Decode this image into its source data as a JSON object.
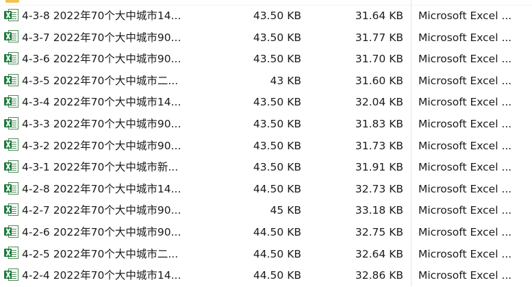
{
  "file_list": {
    "rows": [
      {
        "name": "4-3-8 2022年70个大中城市14...",
        "size": "43.50 KB",
        "packed": "31.64 KB",
        "type": "Microsoft Excel ..."
      },
      {
        "name": "4-3-7 2022年70个大中城市90...",
        "size": "43.50 KB",
        "packed": "31.77 KB",
        "type": "Microsoft Excel ..."
      },
      {
        "name": "4-3-6 2022年70个大中城市90...",
        "size": "43.50 KB",
        "packed": "31.70 KB",
        "type": "Microsoft Excel ..."
      },
      {
        "name": "4-3-5 2022年70个大中城市二...",
        "size": "43 KB",
        "packed": "31.60 KB",
        "type": "Microsoft Excel ..."
      },
      {
        "name": "4-3-4 2022年70个大中城市14...",
        "size": "43.50 KB",
        "packed": "32.04 KB",
        "type": "Microsoft Excel ..."
      },
      {
        "name": "4-3-3 2022年70个大中城市90...",
        "size": "43.50 KB",
        "packed": "31.83 KB",
        "type": "Microsoft Excel ..."
      },
      {
        "name": "4-3-2 2022年70个大中城市90...",
        "size": "43.50 KB",
        "packed": "31.73 KB",
        "type": "Microsoft Excel ..."
      },
      {
        "name": "4-3-1 2022年70个大中城市新...",
        "size": "43.50 KB",
        "packed": "31.91 KB",
        "type": "Microsoft Excel ..."
      },
      {
        "name": "4-2-8 2022年70个大中城市14...",
        "size": "44.50 KB",
        "packed": "32.73 KB",
        "type": "Microsoft Excel ..."
      },
      {
        "name": "4-2-7 2022年70个大中城市90...",
        "size": "45 KB",
        "packed": "33.18 KB",
        "type": "Microsoft Excel ..."
      },
      {
        "name": "4-2-6 2022年70个大中城市90...",
        "size": "44.50 KB",
        "packed": "32.75 KB",
        "type": "Microsoft Excel ..."
      },
      {
        "name": "4-2-5 2022年70个大中城市二...",
        "size": "44.50 KB",
        "packed": "32.64 KB",
        "type": "Microsoft Excel ..."
      },
      {
        "name": "4-2-4 2022年70个大中城市14...",
        "size": "44.50 KB",
        "packed": "32.86 KB",
        "type": "Microsoft Excel ..."
      }
    ]
  },
  "icons": {
    "file_icon": "excel-file-icon",
    "folder_icon": "folder-icon"
  },
  "colors": {
    "excel_green": "#1d7a3e",
    "folder_yellow": "#f3c24f",
    "text": "#1a1a1a"
  }
}
